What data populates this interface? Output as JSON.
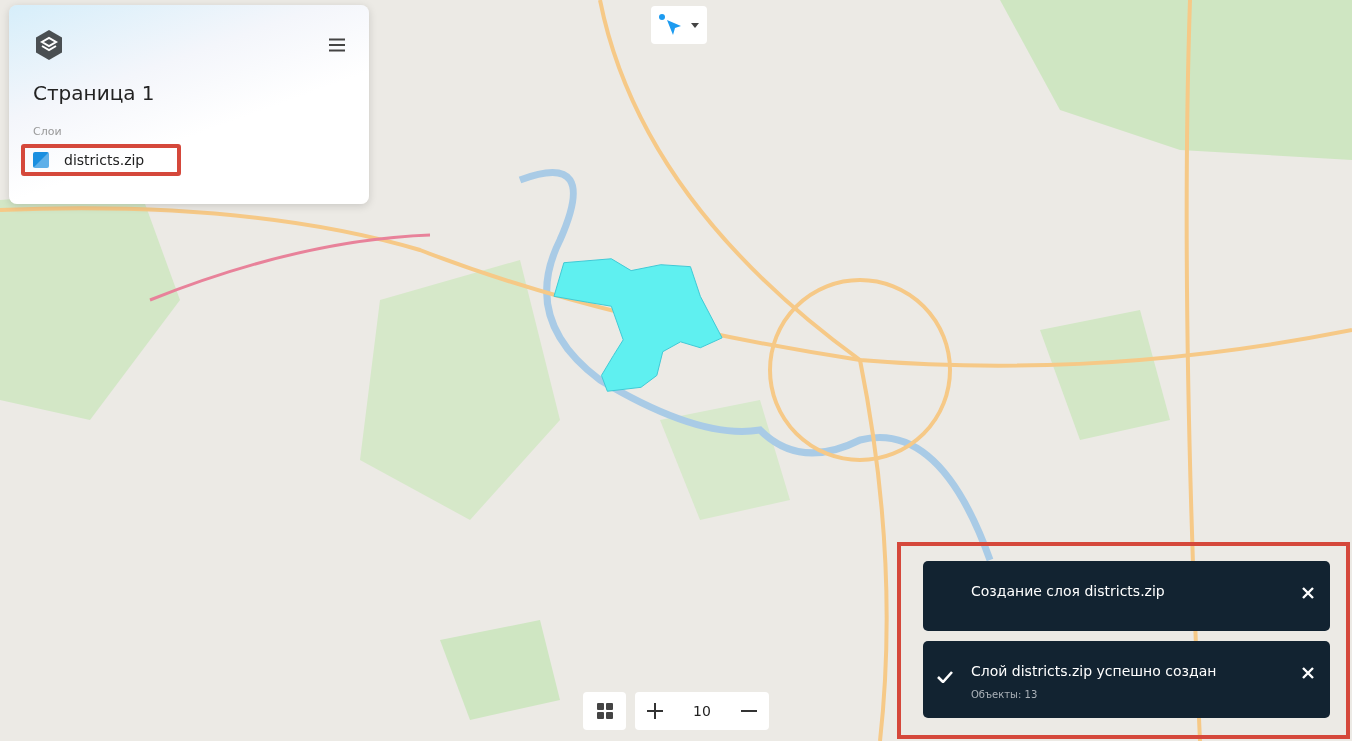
{
  "panel": {
    "title": "Страница 1",
    "section_label": "Слои",
    "layers": [
      {
        "name": "districts.zip",
        "color": "#1a8fe0",
        "highlighted": true
      }
    ]
  },
  "map_layer": {
    "kind": "polygon",
    "color": "#5ff0f0"
  },
  "zoom": {
    "value": "10"
  },
  "toasts": {
    "highlighted": true,
    "items": [
      {
        "kind": "progress",
        "title": "Создание слоя districts.zip"
      },
      {
        "kind": "success",
        "title": "Слой districts.zip успешно создан",
        "detail": "Объекты: 13"
      }
    ]
  }
}
